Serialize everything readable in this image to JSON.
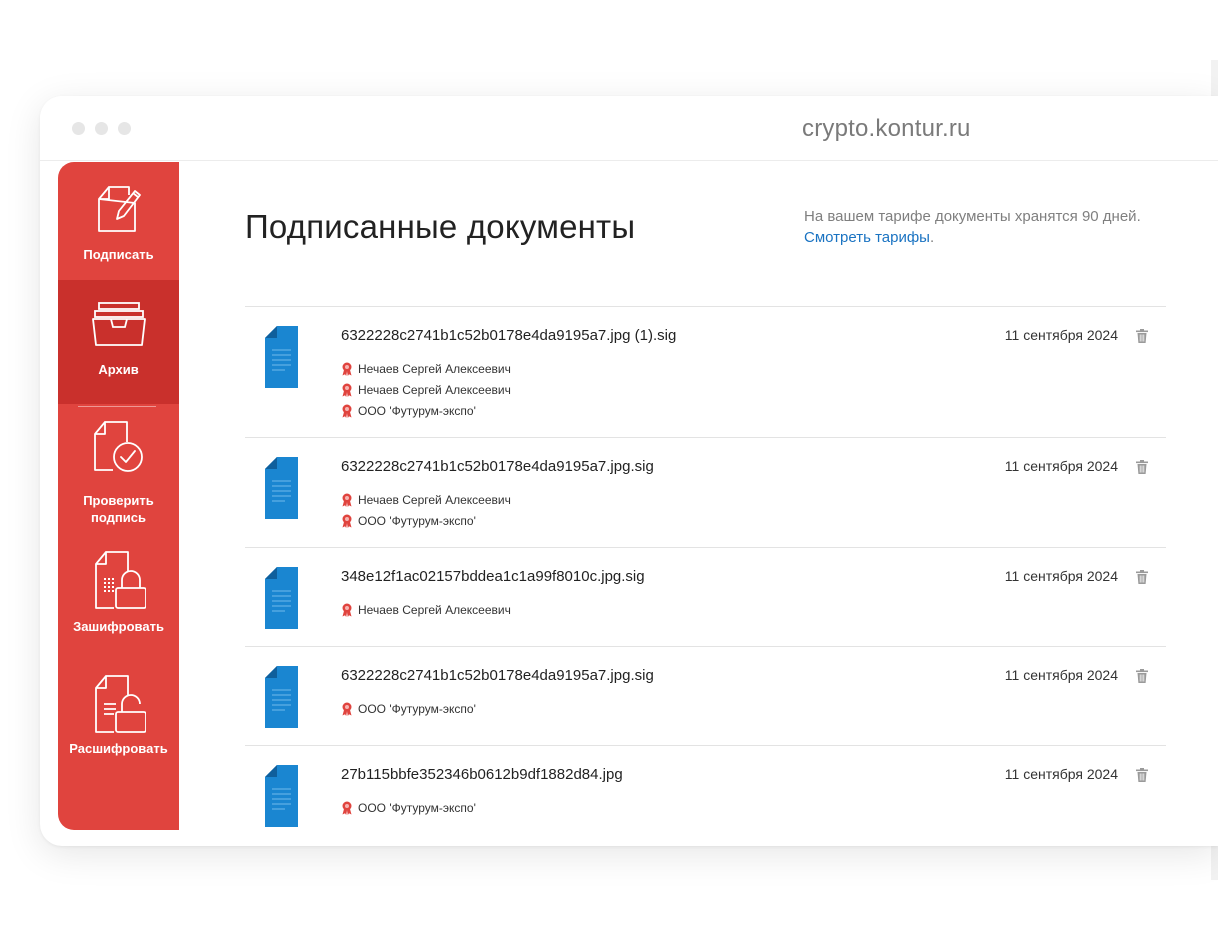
{
  "browser": {
    "url": "crypto.kontur.ru"
  },
  "sidebar": {
    "items": [
      {
        "label": "Подписать",
        "icon": "sign-document-icon",
        "active": false
      },
      {
        "label": "Архив",
        "icon": "archive-icon",
        "active": true
      },
      {
        "label": "Проверить подпись",
        "icon": "verify-signature-icon",
        "active": false
      },
      {
        "label": "Зашифровать",
        "icon": "encrypt-lock-icon",
        "active": false
      },
      {
        "label": "Расшифровать",
        "icon": "decrypt-lock-icon",
        "active": false
      }
    ]
  },
  "main": {
    "title": "Подписанные документы",
    "tariff_note": "На вашем тарифе документы хранятся 90 дней.",
    "tariff_link": "Смотреть тарифы",
    "tariff_link_suffix": "."
  },
  "documents": [
    {
      "name": "6322228c2741b1c52b0178e4da9195a7.jpg (1).sig",
      "date": "11 сентября 2024",
      "signers": [
        "Нечаев Сергей Алексеевич",
        "Нечаев Сергей Алексеевич",
        "ООО 'Футурум-экспо'"
      ]
    },
    {
      "name": "6322228c2741b1c52b0178e4da9195a7.jpg.sig",
      "date": "11 сентября 2024",
      "signers": [
        "Нечаев Сергей Алексеевич",
        "ООО 'Футурум-экспо'"
      ]
    },
    {
      "name": "348e12f1ac02157bddea1c1a99f8010c.jpg.sig",
      "date": "11 сентября 2024",
      "signers": [
        "Нечаев Сергей Алексеевич"
      ]
    },
    {
      "name": "6322228c2741b1c52b0178e4da9195a7.jpg.sig",
      "date": "11 сентября 2024",
      "signers": [
        "ООО 'Футурум-экспо'"
      ]
    },
    {
      "name": "27b115bbfe352346b0612b9df1882d84.jpg",
      "date": "11 сентября 2024",
      "signers": [
        "ООО 'Футурум-экспо'"
      ]
    }
  ],
  "colors": {
    "sidebar": "#e0443e",
    "sidebar_active": "#c9302c",
    "doc_icon": "#1a86d1",
    "link": "#1a73c2",
    "seal": "#e0443e"
  }
}
